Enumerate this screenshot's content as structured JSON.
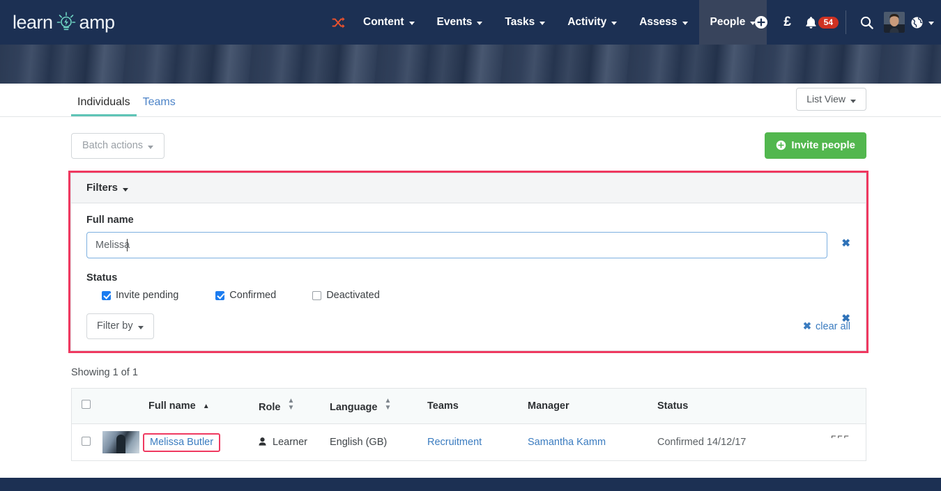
{
  "brand": {
    "name_part1": "learn",
    "name_part2": "amp",
    "logo_icon": "lightbulb-icon",
    "navbar_color": "#1c3053",
    "accent_teal": "#5ec4b6",
    "accent_orange": "#e8512e",
    "highlight_pink": "#ef3960",
    "link_blue": "#3b7cc0",
    "green": "#52b74e"
  },
  "topnav": {
    "shuffle_icon": "shuffle-icon",
    "items": [
      {
        "label": "Content",
        "has_caret": true,
        "active": false
      },
      {
        "label": "Events",
        "has_caret": true,
        "active": false
      },
      {
        "label": "Tasks",
        "has_caret": true,
        "active": false
      },
      {
        "label": "Activity",
        "has_caret": true,
        "active": false
      },
      {
        "label": "Assess",
        "has_caret": true,
        "active": false
      },
      {
        "label": "People",
        "has_caret": true,
        "active": true
      }
    ],
    "add_icon": "plus-circle-icon",
    "currency_icon": "pound-sterling-icon",
    "currency_symbol": "£",
    "bell_icon": "bell-icon",
    "notification_count": "54",
    "search_icon": "search-icon",
    "avatar": "user-avatar",
    "globe_icon": "globe-icon"
  },
  "tabs": [
    {
      "label": "Individuals",
      "active": true
    },
    {
      "label": "Teams",
      "active": false
    }
  ],
  "view_toggle": {
    "label": "List View",
    "caret": true
  },
  "actions": {
    "batch_label": "Batch actions",
    "batch_disabled": true,
    "invite_label": "Invite people",
    "invite_icon": "plus-circle-icon"
  },
  "filters": {
    "header_label": "Filters",
    "full_name": {
      "label": "Full name",
      "value": "Melissa",
      "placeholder": "",
      "remove_icon": "close-icon"
    },
    "status": {
      "label": "Status",
      "remove_icon": "close-icon",
      "options": [
        {
          "label": "Invite pending",
          "checked": true
        },
        {
          "label": "Confirmed",
          "checked": true
        },
        {
          "label": "Deactivated",
          "checked": false
        }
      ]
    },
    "filter_by_label": "Filter by",
    "clear_all_label": "clear all",
    "clear_all_icon": "close-icon"
  },
  "results": {
    "showing_text": "Showing 1 of 1",
    "columns": [
      {
        "key": "checkbox",
        "label": "",
        "sortable": false
      },
      {
        "key": "avatar",
        "label": "",
        "sortable": false
      },
      {
        "key": "fullname",
        "label": "Full name",
        "sort": "asc"
      },
      {
        "key": "role",
        "label": "Role",
        "sort": "none"
      },
      {
        "key": "language",
        "label": "Language",
        "sort": "none"
      },
      {
        "key": "teams",
        "label": "Teams",
        "sortable": false
      },
      {
        "key": "manager",
        "label": "Manager",
        "sortable": false
      },
      {
        "key": "status",
        "label": "Status",
        "sortable": false
      }
    ],
    "rows": [
      {
        "selected": false,
        "avatar": "person-photo",
        "fullname": "Melissa Butler",
        "fullname_highlighted": true,
        "role_icon": "user-icon",
        "role": "Learner",
        "language": "English (GB)",
        "teams": "Recruitment",
        "manager": "Samantha Kamm",
        "status": "Confirmed 14/12/17",
        "row_actions": "⌐⌐⌐"
      }
    ]
  }
}
